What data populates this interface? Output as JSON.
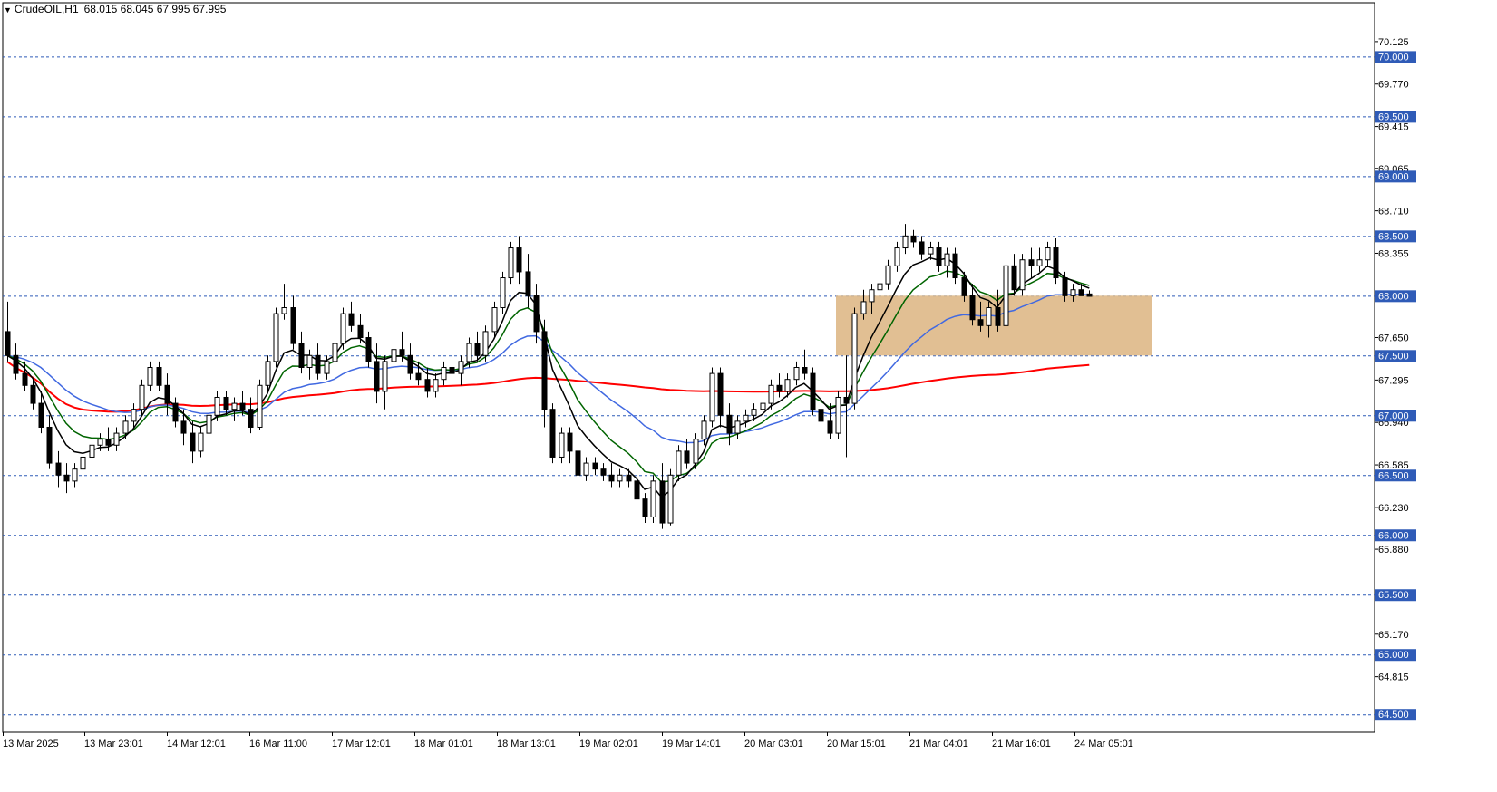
{
  "header": {
    "symbol": "CrudeOIL,H1",
    "ohlc": "68.015 68.045 67.995 67.995"
  },
  "colors": {
    "background": "#ffffff",
    "bull_candle": "#ffffff",
    "bear_candle": "#000000",
    "level_line": "#2f5bb7",
    "level_label_bg": "#2f5bb7",
    "zone_fill": "#deb887",
    "ma_fast": "#000000",
    "ma_mid": "#006400",
    "ma_slow": "#4169e1",
    "ma_long": "#ff0000"
  },
  "chart_data": {
    "type": "candlestick",
    "symbol": "CrudeOIL",
    "timeframe": "H1",
    "ylim": [
      64.35,
      70.45
    ],
    "y_ticks": [
      "70.125",
      "69.770",
      "69.415",
      "69.065",
      "68.710",
      "68.355",
      "67.650",
      "67.295",
      "66.940",
      "66.585",
      "66.230",
      "65.880",
      "65.170",
      "64.815"
    ],
    "level_labels": [
      "70.000",
      "69.500",
      "69.000",
      "68.500",
      "68.000",
      "67.500",
      "67.000",
      "66.500",
      "66.000",
      "65.500",
      "65.000",
      "64.500"
    ],
    "x_tick_labels": [
      "13 Mar 2025",
      "13 Mar 23:01",
      "14 Mar 12:01",
      "16 Mar 11:00",
      "17 Mar 12:01",
      "18 Mar 01:01",
      "18 Mar 13:01",
      "19 Mar 02:01",
      "19 Mar 14:01",
      "20 Mar 03:01",
      "20 Mar 15:01",
      "21 Mar 04:01",
      "21 Mar 16:01",
      "24 Mar 05:01"
    ],
    "zone": {
      "from_label": "20 Mar 15:01",
      "to_bar_offset": 10,
      "low": 67.5,
      "high": 68.0
    },
    "candles": [
      [
        67.7,
        67.95,
        67.45,
        67.5
      ],
      [
        67.5,
        67.6,
        67.3,
        67.35
      ],
      [
        67.35,
        67.45,
        67.2,
        67.25
      ],
      [
        67.25,
        67.3,
        67.05,
        67.1
      ],
      [
        67.1,
        67.2,
        66.85,
        66.9
      ],
      [
        66.9,
        67.0,
        66.55,
        66.6
      ],
      [
        66.6,
        66.7,
        66.4,
        66.5
      ],
      [
        66.5,
        66.6,
        66.35,
        66.45
      ],
      [
        66.45,
        66.6,
        66.4,
        66.55
      ],
      [
        66.55,
        66.7,
        66.5,
        66.65
      ],
      [
        66.65,
        66.8,
        66.6,
        66.75
      ],
      [
        66.75,
        66.85,
        66.7,
        66.8
      ],
      [
        66.8,
        66.9,
        66.7,
        66.75
      ],
      [
        66.75,
        66.9,
        66.7,
        66.85
      ],
      [
        66.85,
        67.0,
        66.8,
        66.95
      ],
      [
        66.95,
        67.1,
        66.9,
        67.05
      ],
      [
        67.05,
        67.3,
        67.0,
        67.25
      ],
      [
        67.25,
        67.45,
        67.2,
        67.4
      ],
      [
        67.4,
        67.45,
        67.2,
        67.25
      ],
      [
        67.25,
        67.35,
        67.0,
        67.1
      ],
      [
        67.1,
        67.15,
        66.9,
        66.95
      ],
      [
        66.95,
        67.05,
        66.75,
        66.85
      ],
      [
        66.85,
        66.95,
        66.6,
        66.7
      ],
      [
        66.7,
        66.9,
        66.65,
        66.85
      ],
      [
        66.85,
        67.05,
        66.8,
        67.0
      ],
      [
        67.0,
        67.2,
        66.95,
        67.15
      ],
      [
        67.15,
        67.2,
        67.0,
        67.05
      ],
      [
        67.05,
        67.15,
        66.95,
        67.1
      ],
      [
        67.1,
        67.2,
        67.0,
        67.05
      ],
      [
        67.05,
        67.15,
        66.85,
        66.9
      ],
      [
        66.9,
        67.3,
        66.88,
        67.25
      ],
      [
        67.25,
        67.5,
        67.2,
        67.45
      ],
      [
        67.45,
        67.9,
        67.4,
        67.85
      ],
      [
        67.85,
        68.1,
        67.8,
        67.9
      ],
      [
        67.9,
        68.0,
        67.55,
        67.6
      ],
      [
        67.6,
        67.7,
        67.35,
        67.4
      ],
      [
        67.4,
        67.55,
        67.3,
        67.5
      ],
      [
        67.5,
        67.6,
        67.3,
        67.35
      ],
      [
        67.35,
        67.5,
        67.3,
        67.45
      ],
      [
        67.45,
        67.65,
        67.4,
        67.6
      ],
      [
        67.6,
        67.9,
        67.55,
        67.85
      ],
      [
        67.85,
        67.95,
        67.7,
        67.75
      ],
      [
        67.75,
        67.85,
        67.6,
        67.65
      ],
      [
        67.65,
        67.7,
        67.4,
        67.45
      ],
      [
        67.45,
        67.6,
        67.1,
        67.2
      ],
      [
        67.2,
        67.5,
        67.05,
        67.45
      ],
      [
        67.45,
        67.6,
        67.4,
        67.55
      ],
      [
        67.55,
        67.7,
        67.45,
        67.5
      ],
      [
        67.5,
        67.6,
        67.3,
        67.35
      ],
      [
        67.35,
        67.45,
        67.25,
        67.3
      ],
      [
        67.3,
        67.4,
        67.15,
        67.2
      ],
      [
        67.2,
        67.35,
        67.15,
        67.3
      ],
      [
        67.3,
        67.45,
        67.25,
        67.4
      ],
      [
        67.4,
        67.5,
        67.3,
        67.35
      ],
      [
        67.35,
        67.5,
        67.25,
        67.45
      ],
      [
        67.45,
        67.65,
        67.4,
        67.6
      ],
      [
        67.6,
        67.7,
        67.45,
        67.5
      ],
      [
        67.5,
        67.75,
        67.45,
        67.7
      ],
      [
        67.7,
        67.95,
        67.65,
        67.9
      ],
      [
        67.9,
        68.2,
        67.85,
        68.15
      ],
      [
        68.15,
        68.45,
        68.1,
        68.4
      ],
      [
        68.4,
        68.5,
        68.1,
        68.2
      ],
      [
        68.2,
        68.35,
        67.9,
        68.0
      ],
      [
        68.0,
        68.1,
        67.6,
        67.7
      ],
      [
        67.7,
        67.8,
        66.9,
        67.05
      ],
      [
        67.05,
        67.1,
        66.6,
        66.65
      ],
      [
        66.65,
        66.9,
        66.6,
        66.85
      ],
      [
        66.85,
        66.9,
        66.6,
        66.7
      ],
      [
        66.7,
        66.75,
        66.45,
        66.5
      ],
      [
        66.5,
        66.65,
        66.45,
        66.6
      ],
      [
        66.6,
        66.65,
        66.5,
        66.55
      ],
      [
        66.55,
        66.6,
        66.45,
        66.5
      ],
      [
        66.5,
        66.6,
        66.4,
        66.45
      ],
      [
        66.45,
        66.55,
        66.4,
        66.5
      ],
      [
        66.5,
        66.55,
        66.4,
        66.45
      ],
      [
        66.45,
        66.5,
        66.25,
        66.3
      ],
      [
        66.3,
        66.35,
        66.1,
        66.15
      ],
      [
        66.15,
        66.5,
        66.1,
        66.45
      ],
      [
        66.45,
        66.6,
        66.05,
        66.1
      ],
      [
        66.1,
        66.55,
        66.08,
        66.5
      ],
      [
        66.5,
        66.75,
        66.45,
        66.7
      ],
      [
        66.7,
        66.8,
        66.55,
        66.6
      ],
      [
        66.6,
        66.85,
        66.55,
        66.8
      ],
      [
        66.8,
        67.0,
        66.75,
        66.95
      ],
      [
        66.95,
        67.4,
        66.9,
        67.35
      ],
      [
        67.35,
        67.4,
        66.9,
        67.0
      ],
      [
        67.0,
        67.1,
        66.75,
        66.85
      ],
      [
        66.85,
        67.0,
        66.8,
        66.95
      ],
      [
        66.95,
        67.05,
        66.9,
        67.0
      ],
      [
        67.0,
        67.1,
        66.95,
        67.05
      ],
      [
        67.05,
        67.15,
        66.95,
        67.1
      ],
      [
        67.1,
        67.3,
        67.05,
        67.25
      ],
      [
        67.25,
        67.35,
        67.15,
        67.2
      ],
      [
        67.2,
        67.35,
        67.15,
        67.3
      ],
      [
        67.3,
        67.45,
        67.25,
        67.4
      ],
      [
        67.4,
        67.55,
        67.3,
        67.35
      ],
      [
        67.35,
        67.4,
        67.0,
        67.05
      ],
      [
        67.05,
        67.15,
        66.85,
        66.95
      ],
      [
        66.95,
        67.1,
        66.8,
        66.85
      ],
      [
        66.85,
        67.2,
        66.8,
        67.15
      ],
      [
        67.15,
        67.5,
        66.65,
        67.1
      ],
      [
        67.1,
        67.9,
        67.05,
        67.85
      ],
      [
        67.85,
        68.05,
        67.8,
        67.95
      ],
      [
        67.95,
        68.1,
        67.85,
        68.05
      ],
      [
        68.05,
        68.2,
        67.95,
        68.1
      ],
      [
        68.1,
        68.3,
        68.05,
        68.25
      ],
      [
        68.25,
        68.45,
        68.2,
        68.4
      ],
      [
        68.4,
        68.6,
        68.35,
        68.5
      ],
      [
        68.5,
        68.55,
        68.4,
        68.45
      ],
      [
        68.45,
        68.5,
        68.3,
        68.35
      ],
      [
        68.35,
        68.45,
        68.3,
        68.4
      ],
      [
        68.4,
        68.45,
        68.2,
        68.25
      ],
      [
        68.25,
        68.4,
        68.15,
        68.35
      ],
      [
        68.35,
        68.4,
        68.1,
        68.15
      ],
      [
        68.15,
        68.2,
        67.95,
        68.0
      ],
      [
        68.0,
        68.1,
        67.75,
        67.8
      ],
      [
        67.8,
        67.95,
        67.7,
        67.75
      ],
      [
        67.75,
        67.95,
        67.65,
        67.9
      ],
      [
        67.9,
        68.05,
        67.7,
        67.75
      ],
      [
        67.75,
        68.3,
        67.7,
        68.25
      ],
      [
        68.25,
        68.35,
        68.0,
        68.05
      ],
      [
        68.05,
        68.35,
        68.0,
        68.3
      ],
      [
        68.3,
        68.4,
        68.15,
        68.25
      ],
      [
        68.25,
        68.4,
        68.2,
        68.3
      ],
      [
        68.3,
        68.45,
        68.25,
        68.4
      ],
      [
        68.4,
        68.48,
        68.1,
        68.15
      ],
      [
        68.15,
        68.2,
        67.95,
        68.0
      ],
      [
        68.0,
        68.1,
        67.95,
        68.05
      ],
      [
        68.05,
        68.1,
        68.0,
        68.0
      ],
      [
        68.015,
        68.045,
        67.995,
        67.995
      ]
    ]
  }
}
